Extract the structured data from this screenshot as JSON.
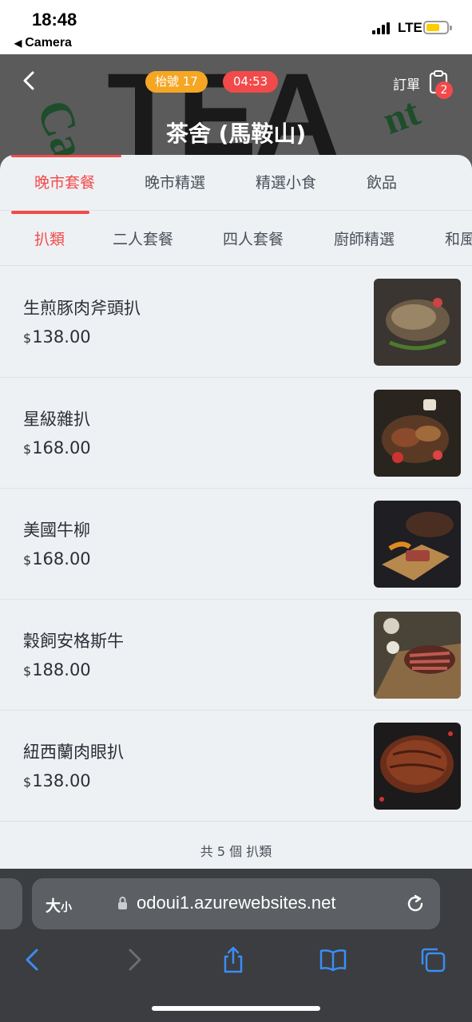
{
  "status_bar": {
    "time": "18:48",
    "back_app": "Camera",
    "network": "LTE"
  },
  "header": {
    "banner_text": "TEA",
    "queue_label": "枱號 17",
    "timer": "04:53",
    "order_label": "訂單",
    "order_count": "2",
    "store_title": "茶舍 (馬鞍山)"
  },
  "main_tabs": [
    {
      "label": "晚市套餐",
      "active": true
    },
    {
      "label": "晚市精選",
      "active": false
    },
    {
      "label": "精選小食",
      "active": false
    },
    {
      "label": "飲品",
      "active": false
    }
  ],
  "sub_tabs": [
    {
      "label": "扒類",
      "active": true
    },
    {
      "label": "二人套餐",
      "active": false
    },
    {
      "label": "四人套餐",
      "active": false
    },
    {
      "label": "廚師精選",
      "active": false
    },
    {
      "label": "和風",
      "active": false
    }
  ],
  "items": [
    {
      "name": "生煎豚肉斧頭扒",
      "currency": "$",
      "price": "138.00",
      "photo": "pork-chop-photo"
    },
    {
      "name": "星級雜扒",
      "currency": "$",
      "price": "168.00",
      "photo": "mixed-grill-photo"
    },
    {
      "name": "美國牛柳",
      "currency": "$",
      "price": "168.00",
      "photo": "us-beef-tenderloin-photo"
    },
    {
      "name": "穀飼安格斯牛",
      "currency": "$",
      "price": "188.00",
      "photo": "grain-fed-angus-photo"
    },
    {
      "name": "紐西蘭肉眼扒",
      "currency": "$",
      "price": "138.00",
      "photo": "nz-ribeye-photo"
    }
  ],
  "footer": {
    "count_text": "共 5 個 扒類"
  },
  "browser": {
    "text_size_label": "大",
    "text_size_small": "小",
    "url": "odoui1.azurewebsites.net"
  },
  "colors": {
    "accent": "#f24a4a",
    "queue_pill": "#f5a623",
    "background": "#eef1f4"
  }
}
